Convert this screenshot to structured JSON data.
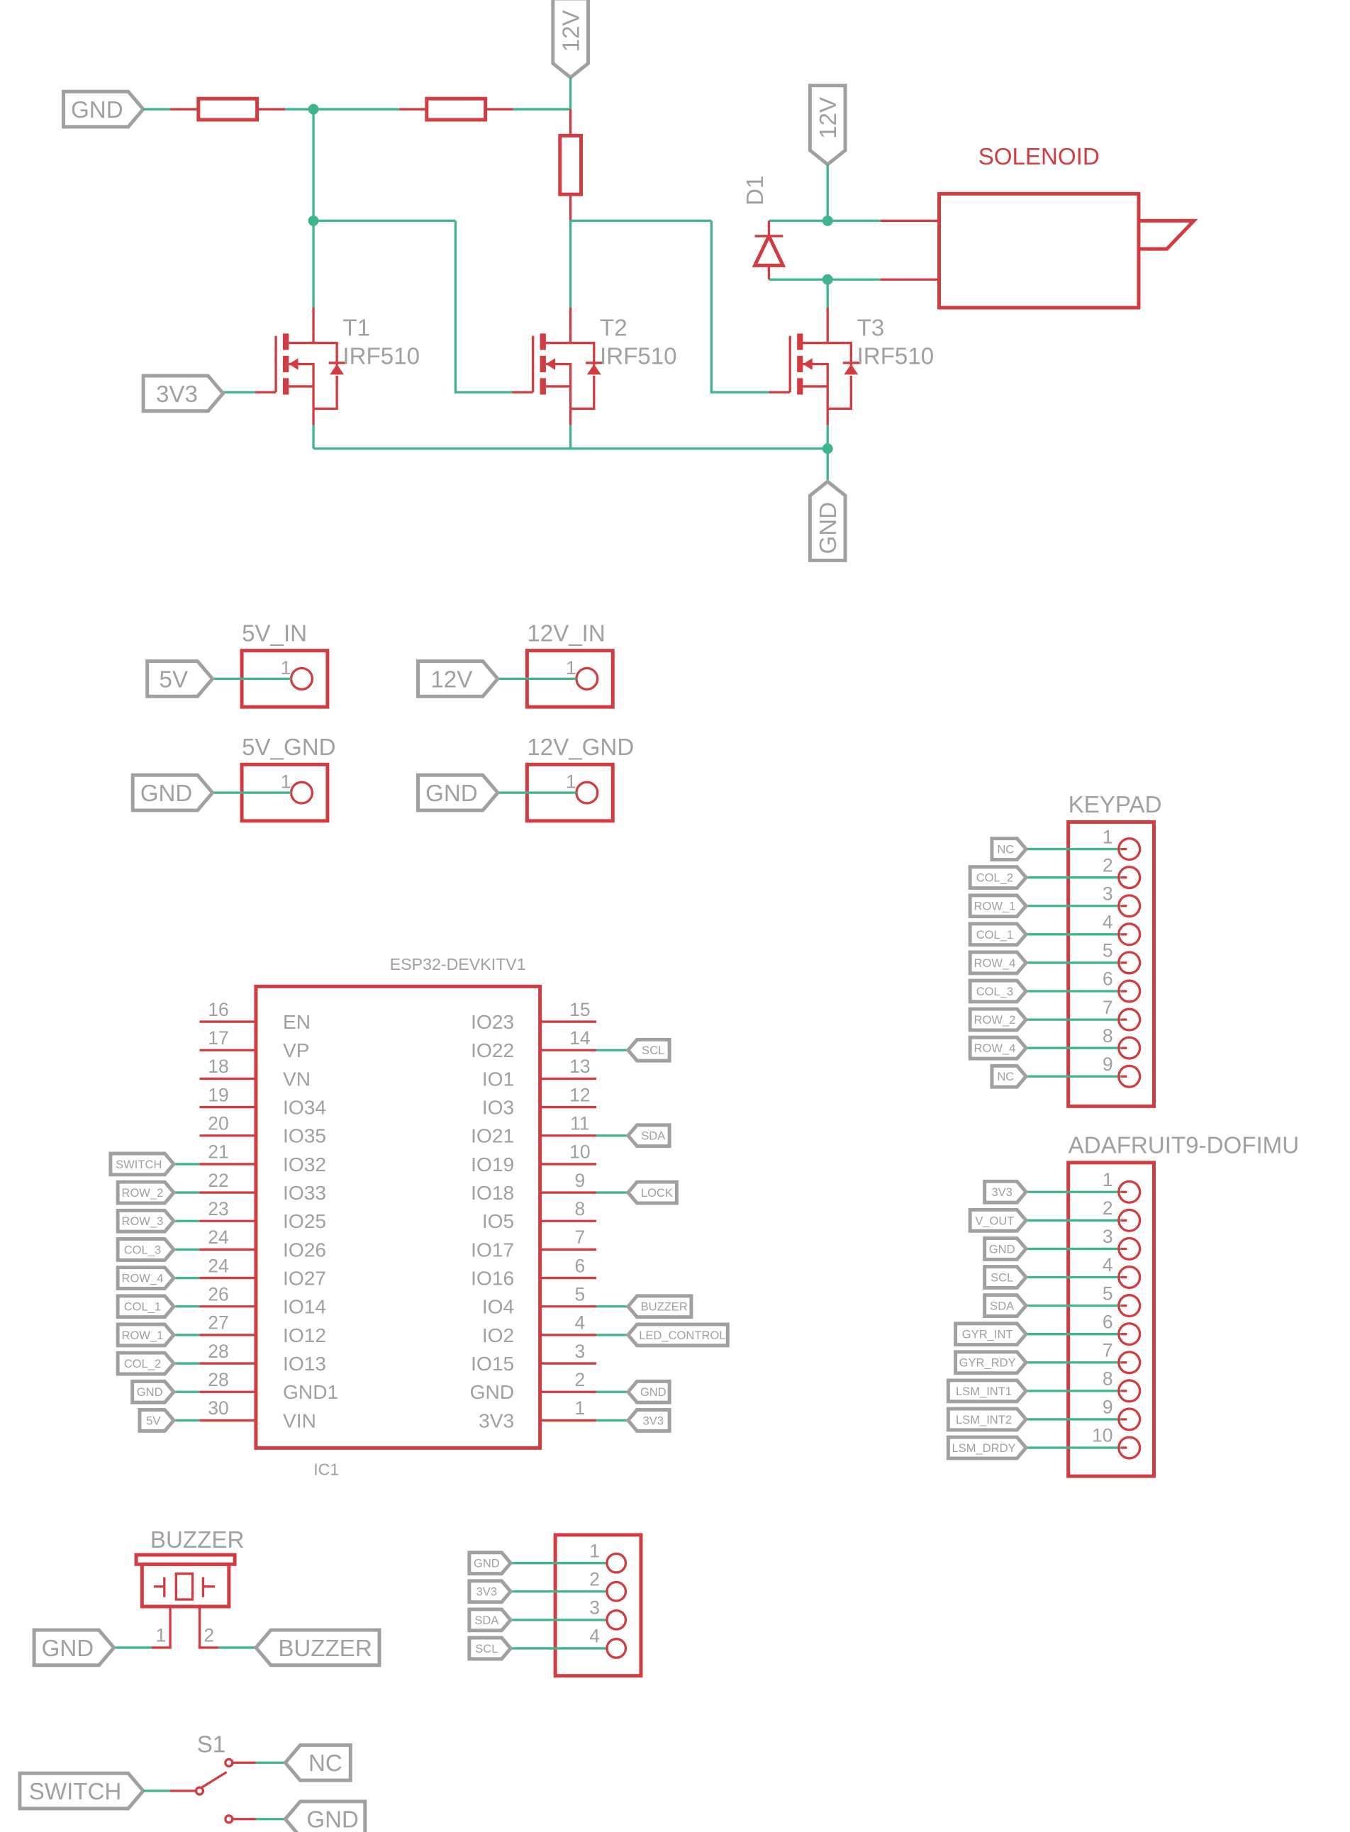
{
  "colors": {
    "wire": "#3fb58c",
    "part": "#d23c40",
    "label": "#a0a0a0",
    "background": "#ffffff"
  },
  "driver": {
    "input_label": "GND",
    "supply_label": "12V",
    "gate_label": "3V3",
    "ground_label": "GND",
    "transistors": [
      {
        "ref": "T1",
        "value": "IRF510"
      },
      {
        "ref": "T2",
        "value": "IRF510"
      },
      {
        "ref": "T3",
        "value": "IRF510"
      }
    ],
    "diode_ref": "D1",
    "solenoid_supply_label": "12V",
    "solenoid_title": "SOLENOID"
  },
  "power_connectors": [
    {
      "name": "5V_IN",
      "net": "5V",
      "pin": "1"
    },
    {
      "name": "12V_IN",
      "net": "12V",
      "pin": "1"
    },
    {
      "name": "5V_GND",
      "net": "GND",
      "pin": "1"
    },
    {
      "name": "12V_GND",
      "net": "GND",
      "pin": "1"
    }
  ],
  "esp32": {
    "title": "ESP32-DEVKITV1",
    "ref": "IC1",
    "left_pins": [
      {
        "num": "16",
        "name": "EN",
        "net": ""
      },
      {
        "num": "17",
        "name": "VP",
        "net": ""
      },
      {
        "num": "18",
        "name": "VN",
        "net": ""
      },
      {
        "num": "19",
        "name": "IO34",
        "net": ""
      },
      {
        "num": "20",
        "name": "IO35",
        "net": ""
      },
      {
        "num": "21",
        "name": "IO32",
        "net": "SWITCH"
      },
      {
        "num": "22",
        "name": "IO33",
        "net": "ROW_2"
      },
      {
        "num": "23",
        "name": "IO25",
        "net": "ROW_3"
      },
      {
        "num": "24",
        "name": "IO26",
        "net": "COL_3"
      },
      {
        "num": "24",
        "name": "IO27",
        "net": "ROW_4"
      },
      {
        "num": "26",
        "name": "IO14",
        "net": "COL_1"
      },
      {
        "num": "27",
        "name": "IO12",
        "net": "ROW_1"
      },
      {
        "num": "28",
        "name": "IO13",
        "net": "COL_2"
      },
      {
        "num": "28",
        "name": "GND1",
        "net": "GND"
      },
      {
        "num": "30",
        "name": "VIN",
        "net": "5V"
      }
    ],
    "right_pins": [
      {
        "num": "15",
        "name": "IO23",
        "net": ""
      },
      {
        "num": "14",
        "name": "IO22",
        "net": "SCL"
      },
      {
        "num": "13",
        "name": "IO1",
        "net": ""
      },
      {
        "num": "12",
        "name": "IO3",
        "net": ""
      },
      {
        "num": "11",
        "name": "IO21",
        "net": "SDA"
      },
      {
        "num": "10",
        "name": "IO19",
        "net": ""
      },
      {
        "num": "9",
        "name": "IO18",
        "net": "LOCK"
      },
      {
        "num": "8",
        "name": "IO5",
        "net": ""
      },
      {
        "num": "7",
        "name": "IO17",
        "net": ""
      },
      {
        "num": "6",
        "name": "IO16",
        "net": ""
      },
      {
        "num": "5",
        "name": "IO4",
        "net": "BUZZER"
      },
      {
        "num": "4",
        "name": "IO2",
        "net": "LED_CONTROL"
      },
      {
        "num": "3",
        "name": "IO15",
        "net": ""
      },
      {
        "num": "2",
        "name": "GND",
        "net": "GND"
      },
      {
        "num": "1",
        "name": "3V3",
        "net": "3V3"
      }
    ]
  },
  "keypad": {
    "title": "KEYPAD",
    "pins": [
      {
        "num": "1",
        "net": "NC"
      },
      {
        "num": "2",
        "net": "COL_2"
      },
      {
        "num": "3",
        "net": "ROW_1"
      },
      {
        "num": "4",
        "net": "COL_1"
      },
      {
        "num": "5",
        "net": "ROW_4"
      },
      {
        "num": "6",
        "net": "COL_3"
      },
      {
        "num": "7",
        "net": "ROW_2"
      },
      {
        "num": "8",
        "net": "ROW_4"
      },
      {
        "num": "9",
        "net": "NC"
      }
    ]
  },
  "imu": {
    "title": "ADAFRUIT9-DOFIMU",
    "pins": [
      {
        "num": "1",
        "net": "3V3"
      },
      {
        "num": "2",
        "net": "V_OUT"
      },
      {
        "num": "3",
        "net": "GND"
      },
      {
        "num": "4",
        "net": "SCL"
      },
      {
        "num": "5",
        "net": "SDA"
      },
      {
        "num": "6",
        "net": "GYR_INT"
      },
      {
        "num": "7",
        "net": "GYR_RDY"
      },
      {
        "num": "8",
        "net": "LSM_INT1"
      },
      {
        "num": "9",
        "net": "LSM_INT2"
      },
      {
        "num": "10",
        "net": "LSM_DRDY"
      }
    ]
  },
  "buzzer": {
    "title": "BUZZER",
    "pin1": "1",
    "pin2": "2",
    "net1": "GND",
    "net2": "BUZZER"
  },
  "i2c_header": {
    "pins": [
      {
        "num": "1",
        "net": "GND"
      },
      {
        "num": "2",
        "net": "3V3"
      },
      {
        "num": "3",
        "net": "SDA"
      },
      {
        "num": "4",
        "net": "SCL"
      }
    ]
  },
  "switch": {
    "ref": "S1",
    "common_net": "SWITCH",
    "nc_net": "NC",
    "no_net": "GND"
  }
}
